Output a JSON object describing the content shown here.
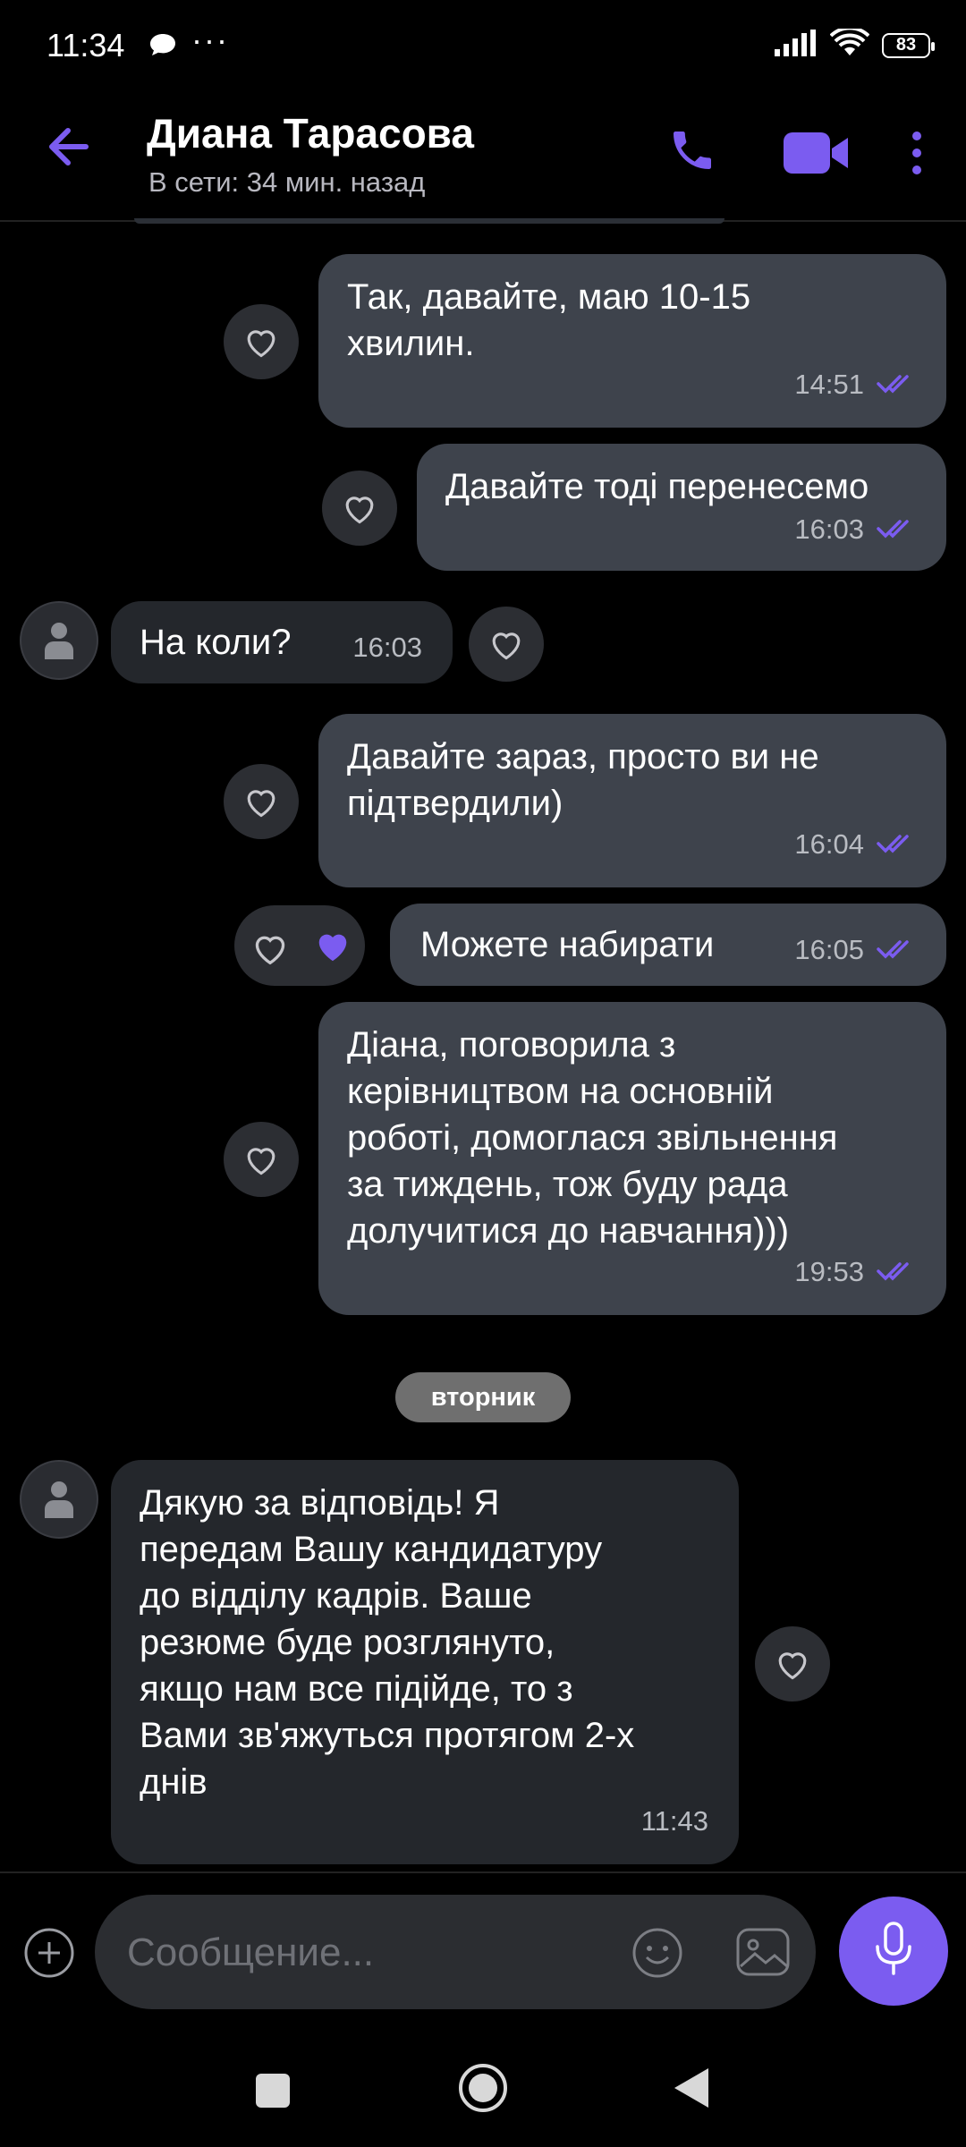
{
  "status_bar": {
    "time": "11:34",
    "dots": "···",
    "battery": "83",
    "icons": [
      "chat-bubble-icon",
      "signal-icon",
      "wifi-icon",
      "battery-icon"
    ]
  },
  "header": {
    "contact_name": "Диана Тарасова",
    "contact_status": "В сети: 34 мин. назад",
    "icons": [
      "back-arrow-icon",
      "phone-icon",
      "video-camera-icon",
      "more-vertical-icon"
    ],
    "accent_color": "#7b5cf0"
  },
  "messages": [
    {
      "direction": "out",
      "text": "Так, давайте, маю 10-15 хвилин.",
      "lines": [
        "Так, давайте, маю 10-15",
        "хвилин."
      ],
      "time": "14:51",
      "status": "read"
    },
    {
      "direction": "out",
      "text": "Давайте тоді перенесемо",
      "time": "16:03",
      "status": "read"
    },
    {
      "direction": "in",
      "text": "На коли?",
      "time": "16:03"
    },
    {
      "direction": "out",
      "text": "Давайте зараз, просто ви не підтвердили)",
      "lines": [
        "Давайте зараз, просто ви не",
        "підтвердили)"
      ],
      "time": "16:04",
      "status": "read"
    },
    {
      "direction": "out",
      "text": "Можете набирати",
      "time": "16:05",
      "status": "read",
      "reaction": "liked"
    },
    {
      "direction": "out",
      "text": "Діана, поговорила з керівництвом на основній роботі, домоглася звільнення за тиждень, тож буду рада долучитися до навчання)))",
      "lines": [
        "Діана, поговорила з",
        "керівництвом на основній",
        "роботі, домоглася звільнення",
        "за тиждень, тож буду рада",
        "долучитися до навчання)))"
      ],
      "time": "19:53",
      "status": "read"
    },
    {
      "direction": "in",
      "text": "Дякую за відповідь! Я передам Вашу кандидатуру до відділу кадрів. Ваше резюме буде розглянуто, якщо нам все підійде, то з Вами зв'яжуться протягом 2-х днів",
      "lines": [
        "Дякую за відповідь! Я",
        "передам Вашу кандидатуру",
        "до відділу кадрів. Ваше",
        "резюме буде розглянуто,",
        "якщо нам все підійде, то з",
        "Вами зв'яжуться протягом 2-х",
        "днів"
      ],
      "time": "11:43"
    }
  ],
  "date_separator": "вторник",
  "composer": {
    "placeholder": "Сообщение...",
    "icons": [
      "add-icon",
      "emoji-icon",
      "gallery-icon",
      "microphone-icon"
    ]
  },
  "colors": {
    "outgoing_bubble": "#3e434c",
    "incoming_bubble": "#24272c",
    "read_check": "#7b5cf0",
    "liked_heart": "#7b5cf0"
  }
}
